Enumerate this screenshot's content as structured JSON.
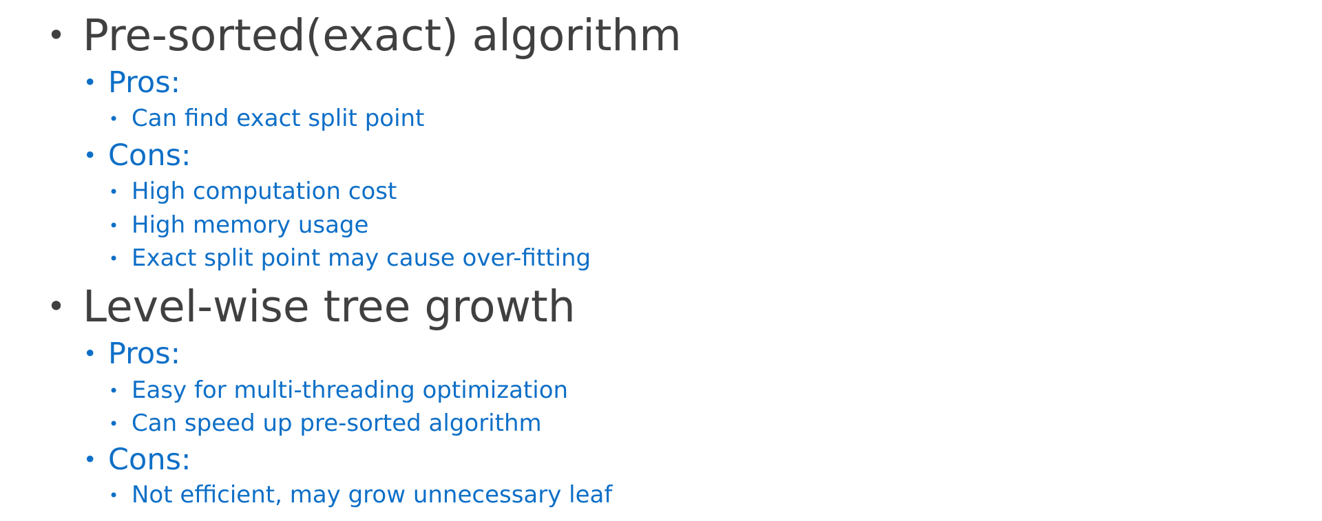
{
  "bullet_glyph": "•",
  "sections": [
    {
      "heading": "Pre-sorted(exact) algorithm",
      "pros_label": "Pros:",
      "pros": [
        "Can find exact split point"
      ],
      "cons_label": "Cons:",
      "cons": [
        "High computation cost",
        "High memory usage",
        "Exact split point may cause over-fitting"
      ]
    },
    {
      "heading": "Level-wise tree growth",
      "pros_label": "Pros:",
      "pros": [
        "Easy for multi-threading optimization",
        "Can speed up pre-sorted algorithm"
      ],
      "cons_label": "Cons:",
      "cons": [
        "Not efficient, may grow unnecessary leaf"
      ]
    }
  ],
  "colors": {
    "heading": "#404040",
    "sub": "#0E6FC7"
  }
}
